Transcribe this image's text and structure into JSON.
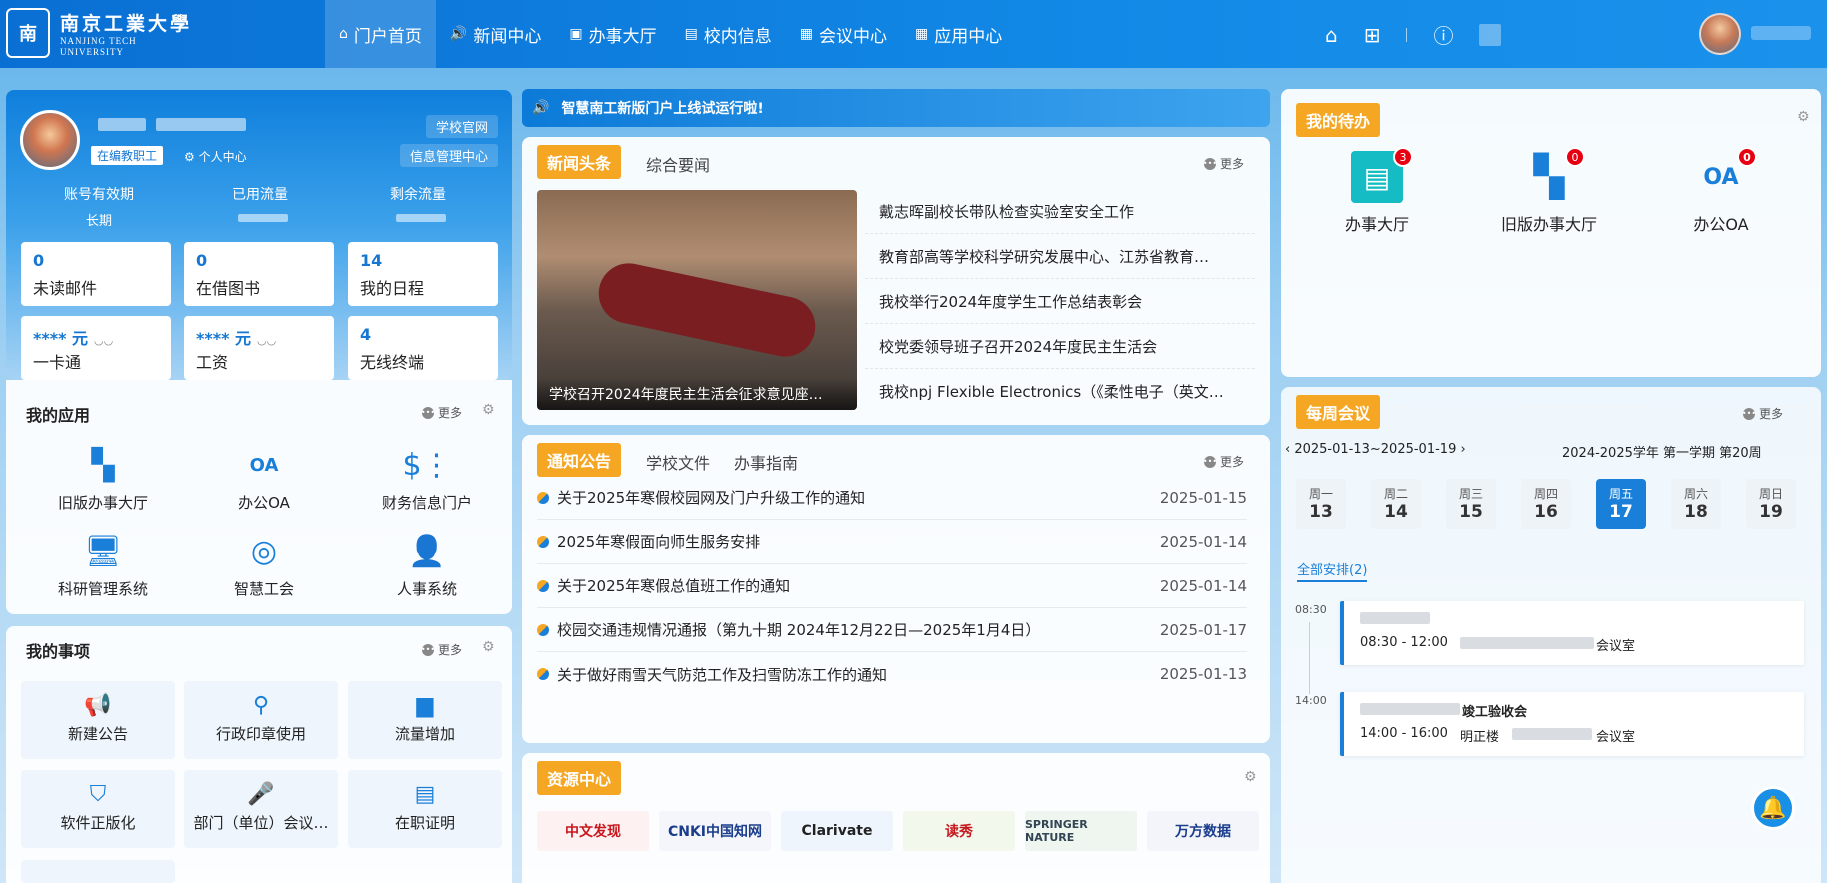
{
  "header": {
    "logo_cn": "南京工業大學",
    "logo_en_line1": "NANJING TECH",
    "logo_en_line2": "UNIVERSITY",
    "nav": [
      {
        "label": "门户首页",
        "icon": "home-outline-icon"
      },
      {
        "label": "新闻中心",
        "icon": "speaker-icon"
      },
      {
        "label": "办事大厅",
        "icon": "bag-icon"
      },
      {
        "label": "校内信息",
        "icon": "document-icon"
      },
      {
        "label": "会议中心",
        "icon": "calendar-icon"
      },
      {
        "label": "应用中心",
        "icon": "grid-icon"
      }
    ],
    "accent_color": "#0a6fd3"
  },
  "profile": {
    "role_tag": "在编教职工",
    "personal_center": "个人中心",
    "link_school": "学校官网",
    "link_info": "信息管理中心",
    "stats": [
      {
        "label": "账号有效期",
        "value": "长期"
      },
      {
        "label": "已用流量",
        "value": ""
      },
      {
        "label": "剩余流量",
        "value": ""
      }
    ],
    "tiles": [
      {
        "value": "0",
        "label": "未读邮件"
      },
      {
        "value": "0",
        "label": "在借图书"
      },
      {
        "value": "14",
        "label": "我的日程"
      },
      {
        "value": "**** 元",
        "label": "一卡通"
      },
      {
        "value": "**** 元",
        "label": "工资"
      },
      {
        "value": "4",
        "label": "无线终端"
      }
    ]
  },
  "my_apps": {
    "title": "我的应用",
    "more": "更多",
    "items": [
      {
        "label": "旧版办事大厅",
        "icon": "tiles-icon"
      },
      {
        "label": "办公OA",
        "icon": "oa-icon"
      },
      {
        "label": "财务信息门户",
        "icon": "finance-icon"
      },
      {
        "label": "科研管理系统",
        "icon": "research-monitor-icon"
      },
      {
        "label": "智慧工会",
        "icon": "union-emblem-icon"
      },
      {
        "label": "人事系统",
        "icon": "hr-person-icon"
      }
    ]
  },
  "my_tasks": {
    "title": "我的事项",
    "more": "更多",
    "items": [
      {
        "label": "新建公告",
        "icon": "megaphone-icon"
      },
      {
        "label": "行政印章使用",
        "icon": "stamp-icon"
      },
      {
        "label": "流量增加",
        "icon": "bar-chart-icon"
      },
      {
        "label": "软件正版化",
        "icon": "shield-zheng-icon"
      },
      {
        "label": "部门（单位）会议…",
        "icon": "mic-sign-icon"
      },
      {
        "label": "在职证明",
        "icon": "certificate-icon"
      }
    ]
  },
  "announcement": "智慧南工新版门户上线试运行啦!",
  "news": {
    "tab_active": "新闻头条",
    "tab_other": "综合要闻",
    "more": "更多",
    "image_caption": "学校召开2024年度民主生活会征求意见座…",
    "items": [
      "戴志晖副校长带队检查实验室安全工作",
      "教育部高等学校科学研究发展中心、江苏省教育…",
      "我校举行2024年度学生工作总结表彰会",
      "校党委领导班子召开2024年度民主生活会",
      "我校npj Flexible Electronics（《柔性电子（英文…"
    ]
  },
  "notices": {
    "tabs": [
      "通知公告",
      "学校文件",
      "办事指南"
    ],
    "more": "更多",
    "items": [
      {
        "title": "关于2025年寒假校园网及门户升级工作的通知",
        "date": "2025-01-15"
      },
      {
        "title": "2025年寒假面向师生服务安排",
        "date": "2025-01-14"
      },
      {
        "title": "关于2025年寒假总值班工作的通知",
        "date": "2025-01-14"
      },
      {
        "title": "校园交通违规情况通报（第九十期 2024年12月22日—2025年1月4日）",
        "date": "2025-01-17"
      },
      {
        "title": "关于做好雨雪天气防范工作及扫雪防冻工作的通知",
        "date": "2025-01-13"
      }
    ]
  },
  "resources": {
    "title": "资源中心",
    "logos": [
      "中文发现",
      "CNKI中国知网",
      "Clarivate",
      "读秀",
      "SPRINGER NATURE",
      "万方数据"
    ]
  },
  "todo": {
    "title": "我的待办",
    "items": [
      {
        "label": "办事大厅",
        "count": "3",
        "icon": "document-tile-icon"
      },
      {
        "label": "旧版办事大厅",
        "count": "0",
        "icon": "tiles-icon"
      },
      {
        "label": "办公OA",
        "count": "0",
        "icon": "oa-icon"
      }
    ]
  },
  "meetings": {
    "title": "每周会议",
    "more": "更多",
    "week_range": "2025-01-13~2025-01-19",
    "term": "2024-2025学年 第一学期 第20周",
    "days": [
      {
        "w": "周一",
        "d": "13"
      },
      {
        "w": "周二",
        "d": "14"
      },
      {
        "w": "周三",
        "d": "15"
      },
      {
        "w": "周四",
        "d": "16"
      },
      {
        "w": "周五",
        "d": "17"
      },
      {
        "w": "周六",
        "d": "18"
      },
      {
        "w": "周日",
        "d": "19"
      }
    ],
    "active_day": "17",
    "all_label": "全部安排(2)",
    "events": [
      {
        "start": "08:30",
        "time": "08:30 - 12:00",
        "title": "",
        "place": "会议室"
      },
      {
        "start": "14:00",
        "time": "14:00 - 16:00",
        "title": "竣工验收会",
        "place_prefix": "明正楼",
        "place": "会议室"
      }
    ]
  }
}
